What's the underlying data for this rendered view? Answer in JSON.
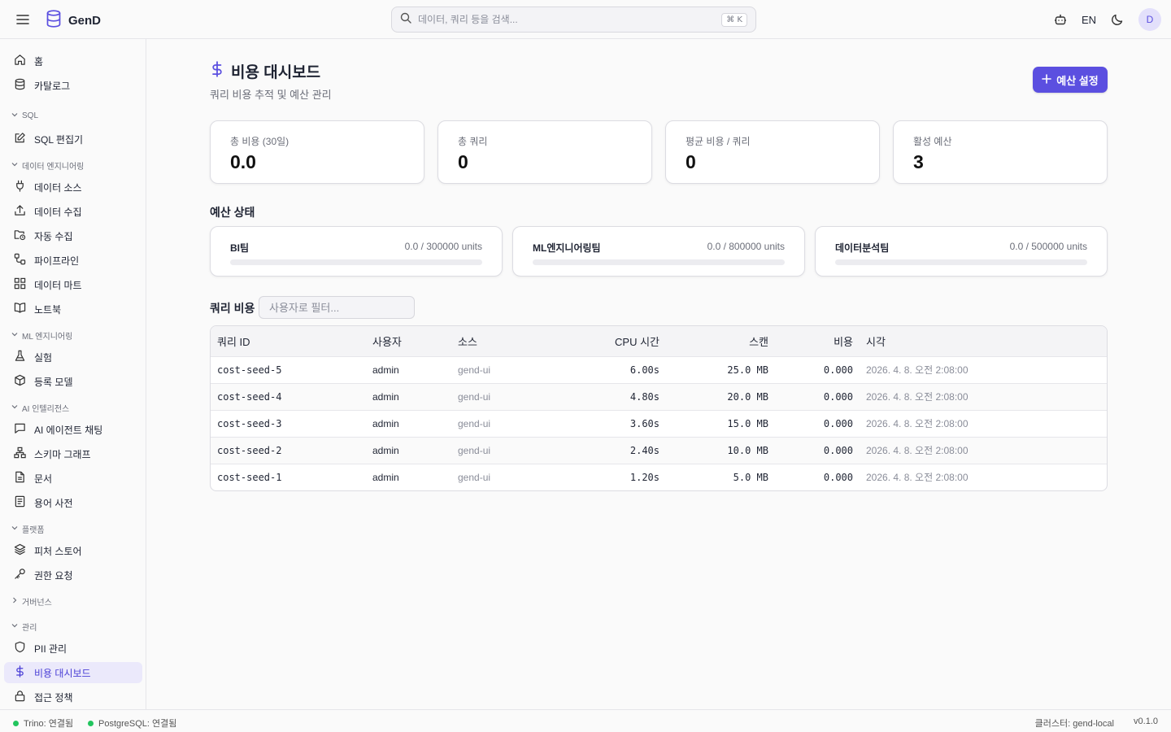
{
  "app": {
    "name": "GenD"
  },
  "search": {
    "placeholder": "데이터, 쿼리 등을 검색...",
    "shortcut": "⌘ K"
  },
  "header": {
    "lang": "EN",
    "avatar": "D"
  },
  "sidebar": {
    "items": [
      {
        "id": "home",
        "label": "홈",
        "icon": "home-icon"
      },
      {
        "id": "catalog",
        "label": "카탈로그",
        "icon": "database-icon"
      },
      {
        "id": "sql-editor",
        "label": "SQL 편집기",
        "icon": "edit-icon"
      },
      {
        "id": "data-source",
        "label": "데이터 소스",
        "icon": "plug-icon"
      },
      {
        "id": "data-ingest",
        "label": "데이터 수집",
        "icon": "upload-icon"
      },
      {
        "id": "auto-ingest",
        "label": "자동 수집",
        "icon": "folder-clock-icon"
      },
      {
        "id": "pipeline",
        "label": "파이프라인",
        "icon": "workflow-icon"
      },
      {
        "id": "data-mart",
        "label": "데이터 마트",
        "icon": "grid-icon"
      },
      {
        "id": "notebook",
        "label": "노트북",
        "icon": "book-icon"
      },
      {
        "id": "experiment",
        "label": "실험",
        "icon": "flask-icon"
      },
      {
        "id": "registered-model",
        "label": "등록 모델",
        "icon": "cube-icon"
      },
      {
        "id": "ai-agent-chat",
        "label": "AI 에이전트 채팅",
        "icon": "chat-icon"
      },
      {
        "id": "schema-graph",
        "label": "스키마 그래프",
        "icon": "network-icon"
      },
      {
        "id": "documents",
        "label": "문서",
        "icon": "file-icon"
      },
      {
        "id": "glossary",
        "label": "용어 사전",
        "icon": "list-icon"
      },
      {
        "id": "feature-store",
        "label": "피처 스토어",
        "icon": "layers-icon"
      },
      {
        "id": "permission-request",
        "label": "권한 요청",
        "icon": "key-icon"
      },
      {
        "id": "pii",
        "label": "PII 관리",
        "icon": "shield-icon"
      },
      {
        "id": "cost-dashboard",
        "label": "비용 대시보드",
        "icon": "dollar-icon"
      },
      {
        "id": "access-policy",
        "label": "접근 정책",
        "icon": "lock-icon"
      }
    ],
    "sections": {
      "sql": "SQL",
      "data_eng": "데이터 엔지니어링",
      "ml_eng": "ML 엔지니어링",
      "ai_intel": "AI 인텔리전스",
      "platform": "플랫폼",
      "governance": "거버넌스",
      "admin": "관리"
    }
  },
  "page": {
    "title": "비용 대시보드",
    "subtitle": "쿼리 비용 추적 및 예산 관리",
    "budget_button": "예산 설정"
  },
  "stats": [
    {
      "label": "총 비용 (30일)",
      "value": "0.0"
    },
    {
      "label": "총 쿼리",
      "value": "0"
    },
    {
      "label": "평균 비용 / 쿼리",
      "value": "0"
    },
    {
      "label": "활성 예산",
      "value": "3"
    }
  ],
  "budget_section": {
    "title": "예산 상태",
    "items": [
      {
        "name": "BI팀",
        "amount": "0.0 / 300000 units",
        "progress": 0
      },
      {
        "name": "ML엔지니어링팀",
        "amount": "0.0 / 800000 units",
        "progress": 0
      },
      {
        "name": "데이터분석팀",
        "amount": "0.0 / 500000 units",
        "progress": 0
      }
    ]
  },
  "query_costs": {
    "title": "쿼리 비용",
    "filter_placeholder": "사용자로 필터...",
    "columns": [
      "쿼리 ID",
      "사용자",
      "소스",
      "CPU 시간",
      "스캔",
      "비용",
      "시각"
    ],
    "rows": [
      {
        "id": "cost-seed-5",
        "user": "admin",
        "source": "gend-ui",
        "cpu": "6.00s",
        "scan": "25.0 MB",
        "cost": "0.000",
        "time": "2026. 4. 8. 오전 2:08:00"
      },
      {
        "id": "cost-seed-4",
        "user": "admin",
        "source": "gend-ui",
        "cpu": "4.80s",
        "scan": "20.0 MB",
        "cost": "0.000",
        "time": "2026. 4. 8. 오전 2:08:00"
      },
      {
        "id": "cost-seed-3",
        "user": "admin",
        "source": "gend-ui",
        "cpu": "3.60s",
        "scan": "15.0 MB",
        "cost": "0.000",
        "time": "2026. 4. 8. 오전 2:08:00"
      },
      {
        "id": "cost-seed-2",
        "user": "admin",
        "source": "gend-ui",
        "cpu": "2.40s",
        "scan": "10.0 MB",
        "cost": "0.000",
        "time": "2026. 4. 8. 오전 2:08:00"
      },
      {
        "id": "cost-seed-1",
        "user": "admin",
        "source": "gend-ui",
        "cpu": "1.20s",
        "scan": "5.0 MB",
        "cost": "0.000",
        "time": "2026. 4. 8. 오전 2:08:00"
      }
    ]
  },
  "statusbar": {
    "trino": "Trino: 연결됨",
    "postgres": "PostgreSQL: 연결됨",
    "cluster": "클러스터: gend-local",
    "version": "v0.1.0"
  },
  "colors": {
    "accent": "#5b4fe0",
    "status_ok": "#22c55e"
  }
}
